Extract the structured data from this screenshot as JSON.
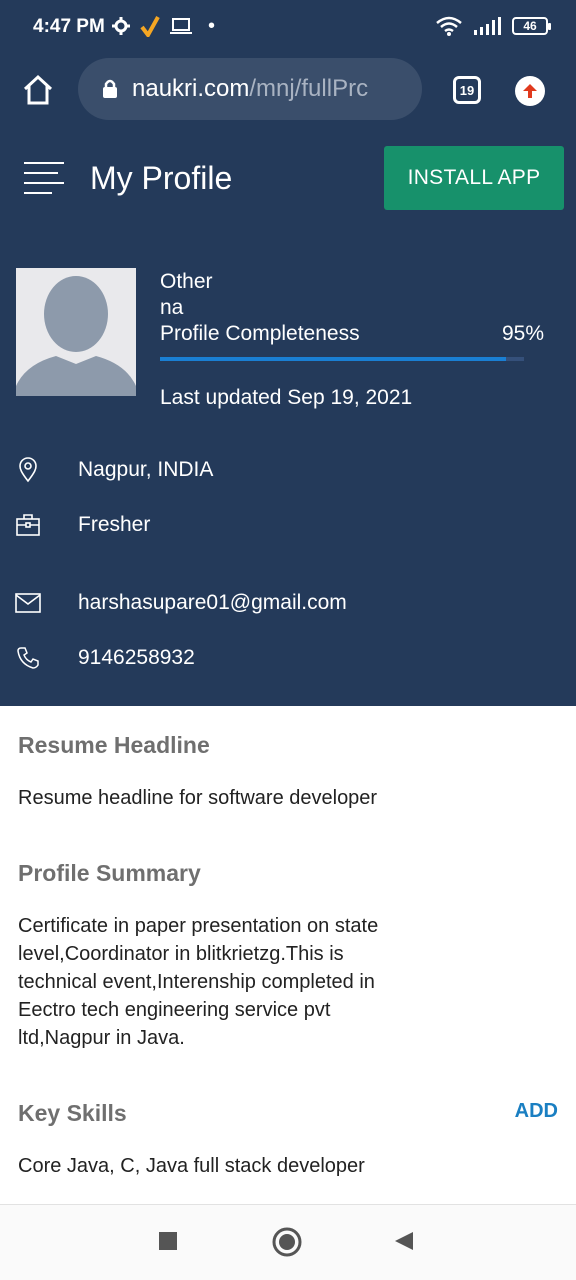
{
  "status_bar": {
    "time": "4:47 PM",
    "battery": "46"
  },
  "browser": {
    "url_host": "naukri.com",
    "url_path": "/mnj/fullPrc",
    "tab_count": "19"
  },
  "header": {
    "title": "My Profile",
    "install_label": "INSTALL APP"
  },
  "profile": {
    "line1": "Other",
    "line2": "na",
    "completeness_label": "Profile Completeness",
    "completeness_value": "95%",
    "completeness_fraction": 0.95,
    "last_updated": "Last updated Sep 19, 2021"
  },
  "details": {
    "location": "Nagpur, INDIA",
    "experience": "Fresher",
    "email": "harshasupare01@gmail.com",
    "phone": "9146258932"
  },
  "sections": {
    "headline_title": "Resume Headline",
    "headline_text": "Resume headline for software developer",
    "summary_title": "Profile Summary",
    "summary_lines": [
      "Certificate in paper presentation on state",
      "level,Coordinator in blitkrietzg.This is",
      "technical event,Interenship completed in",
      "Eectro tech engineering service pvt",
      "ltd,Nagpur in Java."
    ],
    "skills_title": "Key Skills",
    "skills_add": "ADD",
    "skills_text": "Core Java,  C, Java full stack developer"
  },
  "colors": {
    "panel": "#243a5a",
    "install": "#17916b",
    "accent": "#1a7fc2"
  },
  "icons": [
    "home-icon",
    "lock-icon",
    "tabs-icon",
    "update-icon",
    "menu-icon",
    "location-icon",
    "briefcase-icon",
    "mail-icon",
    "phone-icon",
    "recents-icon",
    "home-nav-icon",
    "back-icon"
  ]
}
